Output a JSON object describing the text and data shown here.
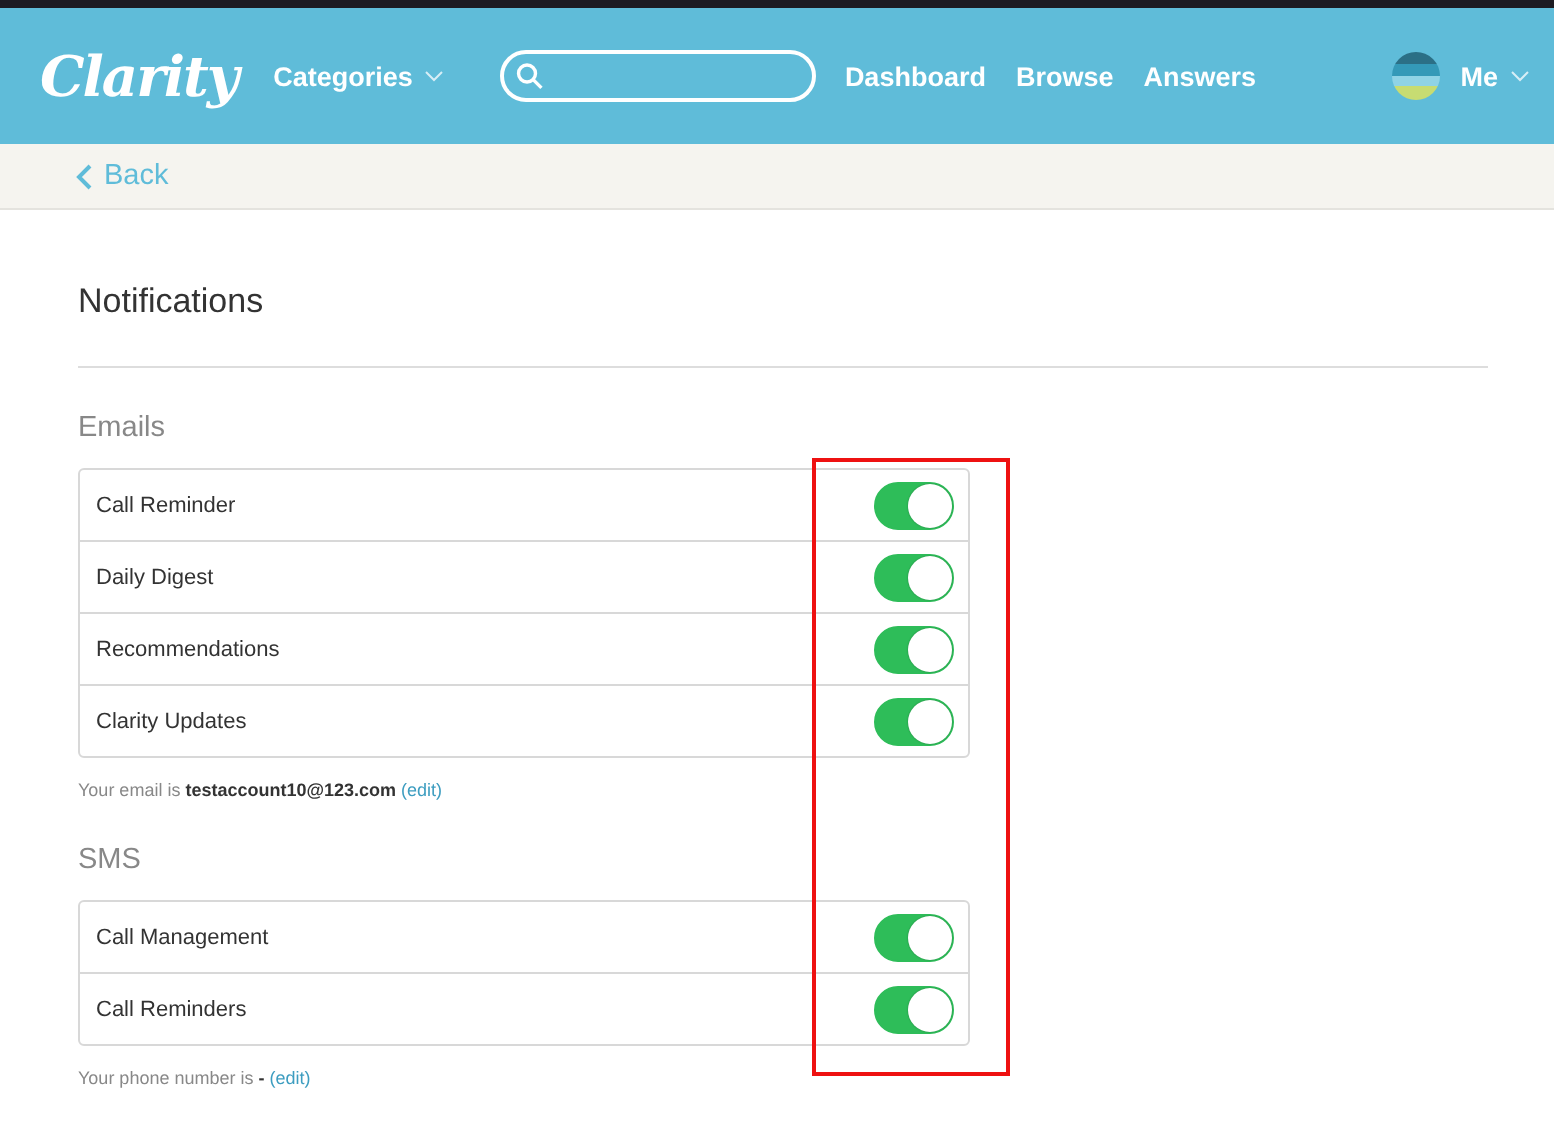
{
  "header": {
    "logo": "Clarity",
    "categories": "Categories",
    "nav": [
      "Dashboard",
      "Browse",
      "Answers"
    ],
    "user": "Me"
  },
  "back": "Back",
  "title": "Notifications",
  "sections": [
    {
      "heading": "Emails",
      "items": [
        {
          "label": "Call Reminder",
          "on": true
        },
        {
          "label": "Daily Digest",
          "on": true
        },
        {
          "label": "Recommendations",
          "on": true
        },
        {
          "label": "Clarity Updates",
          "on": true
        }
      ],
      "note": {
        "text": "Your email is **testaccount10@123.com**",
        "link": "(edit)"
      }
    },
    {
      "heading": "SMS",
      "items": [
        {
          "label": "Call Management",
          "on": true
        },
        {
          "label": "Call Reminders",
          "on": true
        }
      ],
      "note": {
        "text": "Your phone number is **-**",
        "link": "(edit)"
      }
    }
  ],
  "highlight": {
    "shown": true,
    "color": "#ee1111"
  }
}
